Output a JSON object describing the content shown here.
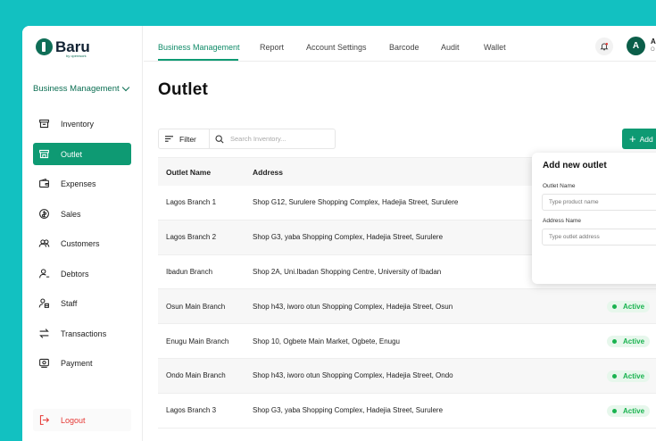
{
  "brand": {
    "name": "Baru",
    "tagline": "by openwork"
  },
  "sidebar": {
    "business_select": "Business Management",
    "items": [
      {
        "label": "Inventory",
        "icon": "box-icon"
      },
      {
        "label": "Outlet",
        "icon": "store-icon"
      },
      {
        "label": "Expenses",
        "icon": "wallet-icon"
      },
      {
        "label": "Sales",
        "icon": "sales-icon"
      },
      {
        "label": "Customers",
        "icon": "users-icon"
      },
      {
        "label": "Debtors",
        "icon": "user-minus-icon"
      },
      {
        "label": "Staff",
        "icon": "staff-icon"
      },
      {
        "label": "Transactions",
        "icon": "arrows-icon"
      },
      {
        "label": "Payment",
        "icon": "payment-icon"
      }
    ],
    "logout": "Logout"
  },
  "topnav": {
    "tabs": [
      "Business Management",
      "Report",
      "Account Settings",
      "Barcode",
      "Audit",
      "Wallet"
    ],
    "user_initial": "A",
    "user_name": "A",
    "user_role": "O"
  },
  "main": {
    "title": "Outlet",
    "filter_label": "Filter",
    "search_placeholder": "Search Inventory...",
    "add_label": "Add",
    "columns": [
      "Outlet Name",
      "Address"
    ],
    "rows": [
      {
        "name": "Lagos Branch 1",
        "address": "Shop G12, Surulere Shopping Complex, Hadejia Street, Surulere",
        "status": ""
      },
      {
        "name": "Lagos Branch 2",
        "address": "Shop G3, yaba Shopping Complex, Hadejia Street, Surulere",
        "status": ""
      },
      {
        "name": "Ibadun Branch",
        "address": "Shop 2A, Uni.Ibadan Shopping Centre, University of Ibadan",
        "status": ""
      },
      {
        "name": "Osun Main Branch",
        "address": "Shop h43, iworo otun Shopping Complex, Hadejia Street, Osun",
        "status": "Active"
      },
      {
        "name": "Enugu Main Branch",
        "address": "Shop 10, Ogbete Main Market, Ogbete, Enugu",
        "status": "Active"
      },
      {
        "name": "Ondo Main Branch",
        "address": "Shop h43, iworo otun Shopping Complex, Hadejia Street, Ondo",
        "status": "Active"
      },
      {
        "name": "Lagos Branch 3",
        "address": "Shop G3, yaba Shopping Complex, Hadejia Street, Surulere",
        "status": "Active"
      }
    ]
  },
  "popup": {
    "title": "Add new outlet",
    "outlet_name_label": "Outlet Name",
    "outlet_name_placeholder": "Type product name",
    "address_label": "Address Name",
    "address_placeholder": "Type outlet address"
  },
  "colors": {
    "accent": "#0e9a73",
    "background": "#12c1c1",
    "active_status": "#19b34f",
    "logout": "#e53935"
  }
}
